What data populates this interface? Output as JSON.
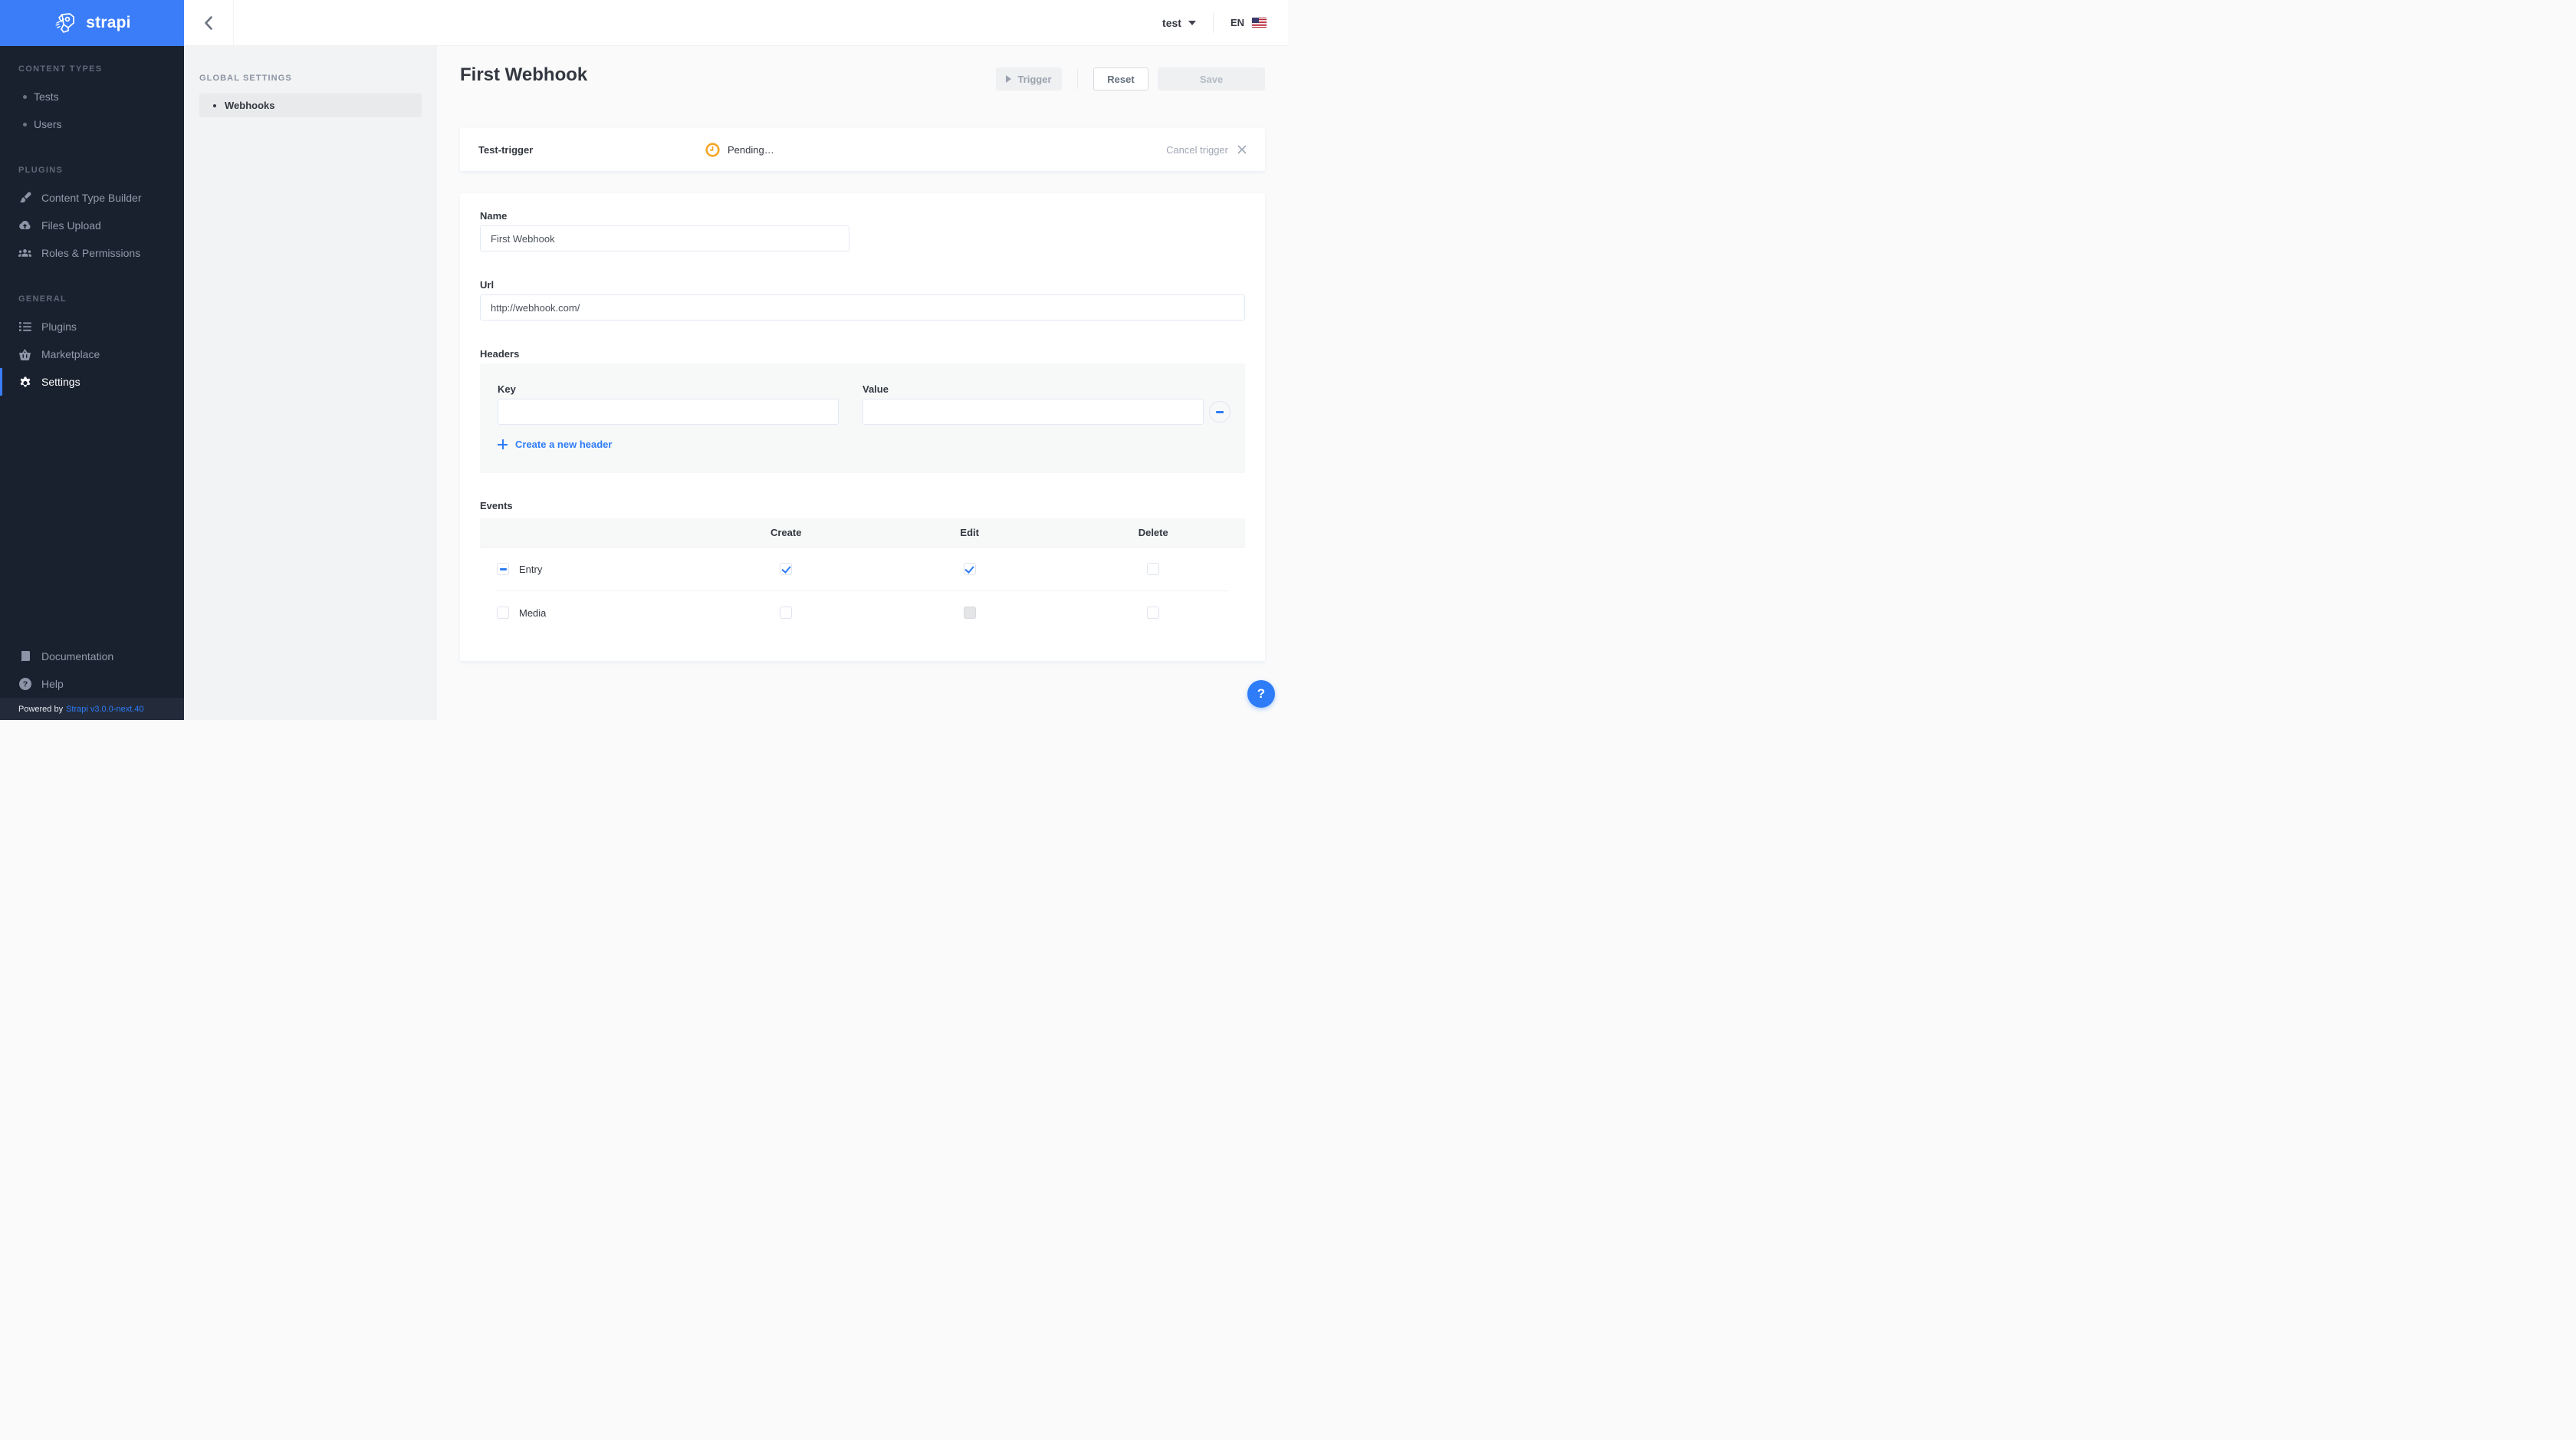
{
  "colors": {
    "accent": "#2e7cf8",
    "brand_blue": "#3b7df8",
    "sidebar_bg": "#1a212e",
    "pending_orange": "#f5a623"
  },
  "brand": {
    "name": "strapi"
  },
  "topbar": {
    "user_label": "test",
    "locale_label": "EN"
  },
  "sidebar": {
    "sections": [
      {
        "title": "CONTENT TYPES",
        "items": [
          {
            "label": "Tests"
          },
          {
            "label": "Users"
          }
        ]
      },
      {
        "title": "PLUGINS",
        "items": [
          {
            "label": "Content Type Builder"
          },
          {
            "label": "Files Upload"
          },
          {
            "label": "Roles & Permissions"
          }
        ]
      },
      {
        "title": "GENERAL",
        "items": [
          {
            "label": "Plugins"
          },
          {
            "label": "Marketplace"
          },
          {
            "label": "Settings",
            "state": "active"
          }
        ]
      }
    ],
    "footer_items": [
      {
        "label": "Documentation"
      },
      {
        "label": "Help"
      }
    ],
    "powered_by": "Powered by",
    "version_link": "Strapi v3.0.0-next.40"
  },
  "settings_nav": {
    "title": "GLOBAL SETTINGS",
    "items": [
      {
        "label": "Webhooks",
        "state": "active"
      }
    ]
  },
  "page": {
    "title": "First Webhook",
    "trigger_button": "Trigger",
    "reset_button": "Reset",
    "save_button": "Save"
  },
  "trigger_bar": {
    "label": "Test-trigger",
    "status_text": "Pending…",
    "cancel_label": "Cancel trigger"
  },
  "form": {
    "name": {
      "label": "Name",
      "value": "First Webhook"
    },
    "url": {
      "label": "Url",
      "value": "http://webhook.com/"
    },
    "headers": {
      "label": "Headers",
      "key_label": "Key",
      "value_label": "Value",
      "key_value": "",
      "value_value": "",
      "add_link": "Create a new header"
    },
    "events": {
      "label": "Events",
      "columns": [
        "Create",
        "Edit",
        "Delete"
      ],
      "rows": [
        {
          "name": "Entry",
          "checkbox": "indeterminate",
          "create": "checked",
          "edit": "checked",
          "delete": "unchecked"
        },
        {
          "name": "Media",
          "checkbox": "unchecked",
          "create": "unchecked",
          "edit": "disabled",
          "delete": "unchecked"
        }
      ]
    }
  },
  "help": {
    "glyph": "?"
  }
}
